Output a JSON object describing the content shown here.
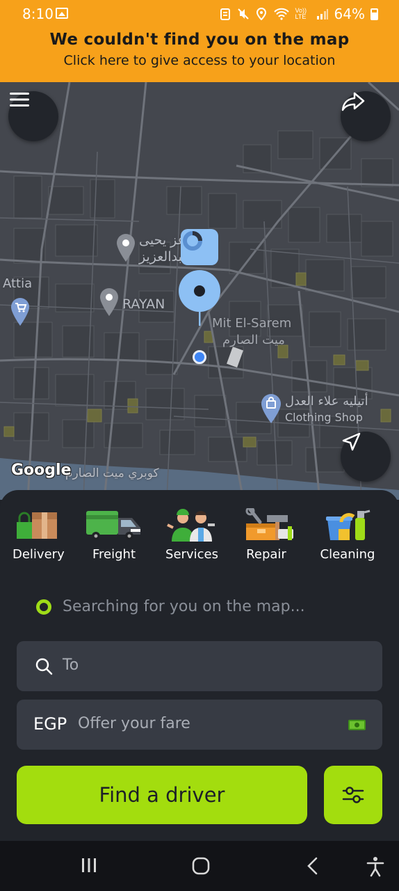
{
  "status_bar": {
    "time": "8:10",
    "battery": "64%",
    "volte": "Vo)) LTE"
  },
  "banner": {
    "title": "We couldn't find you on the map",
    "subtitle": "Click here to give access to your location"
  },
  "map": {
    "labels": {
      "attia": "Attia",
      "rayan": "RAYAN",
      "mit_el_sarem_en": "Mit El-Sarem",
      "mit_el_sarem_ar": "ميت الصارم",
      "yahya_line1": "عز يحيى",
      "yahya_line2": "عبدالعزيز",
      "atelier_ar": "أتيليه علاء العدل",
      "atelier_en": "Clothing Shop",
      "bridge_ar": "كوبري ميت الصارم"
    },
    "google": "Google"
  },
  "services": [
    {
      "label": "Delivery",
      "icon": "delivery-icon"
    },
    {
      "label": "Freight",
      "icon": "freight-truck-icon"
    },
    {
      "label": "Services",
      "icon": "services-workers-icon"
    },
    {
      "label": "Repair",
      "icon": "repair-tools-icon"
    },
    {
      "label": "Cleaning",
      "icon": "cleaning-supplies-icon"
    }
  ],
  "form": {
    "searching": "Searching for you on the map...",
    "to_placeholder": "To",
    "currency": "EGP",
    "fare_placeholder": "Offer your fare",
    "find_button": "Find a driver"
  },
  "colors": {
    "banner": "#f7a11a",
    "accent": "#a3dd0e",
    "sheet": "#21242a",
    "field": "#373b44",
    "map": "#44474e"
  }
}
